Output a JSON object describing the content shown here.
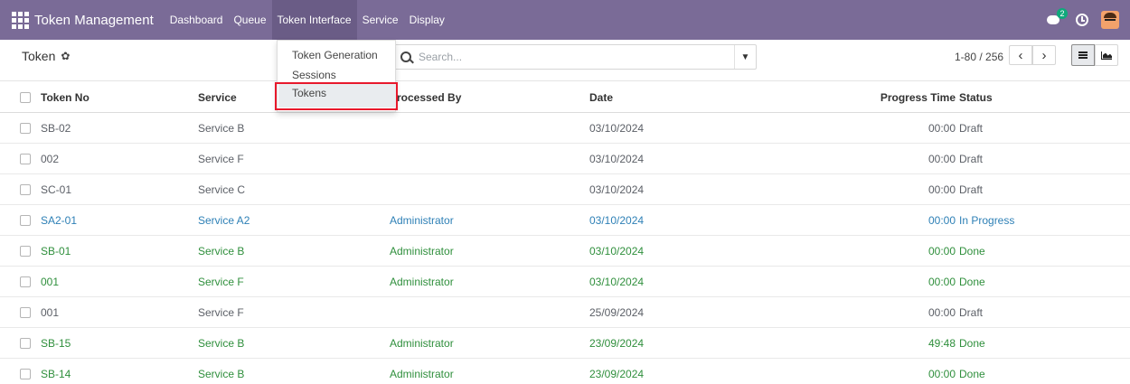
{
  "navbar": {
    "app_name": "Token Management",
    "menu": [
      "Dashboard",
      "Queue",
      "Token Interface",
      "Service",
      "Display"
    ],
    "active_menu": "Token Interface",
    "chat_badge": "2",
    "bg_color": "#7a6b97"
  },
  "dropdown": {
    "items": [
      "Token Generation",
      "Sessions",
      "Tokens"
    ],
    "highlighted": "Tokens"
  },
  "control": {
    "title": "Token",
    "search_placeholder": "Search...",
    "pager": "1-80 / 256",
    "prev": "‹",
    "next": "›"
  },
  "table": {
    "headers": [
      "Token No",
      "Service",
      "Processed By",
      "Date",
      "Progress Time",
      "Status"
    ],
    "rows": [
      {
        "token": "SB-02",
        "service": "Service B",
        "by": "",
        "date": "03/10/2024",
        "time": "00:00",
        "status": "Draft",
        "state": "draft"
      },
      {
        "token": "002",
        "service": "Service F",
        "by": "",
        "date": "03/10/2024",
        "time": "00:00",
        "status": "Draft",
        "state": "draft"
      },
      {
        "token": "SC-01",
        "service": "Service C",
        "by": "",
        "date": "03/10/2024",
        "time": "00:00",
        "status": "Draft",
        "state": "draft"
      },
      {
        "token": "SA2-01",
        "service": "Service A2",
        "by": "Administrator",
        "date": "03/10/2024",
        "time": "00:00",
        "status": "In Progress",
        "state": "progress"
      },
      {
        "token": "SB-01",
        "service": "Service B",
        "by": "Administrator",
        "date": "03/10/2024",
        "time": "00:00",
        "status": "Done",
        "state": "done"
      },
      {
        "token": "001",
        "service": "Service F",
        "by": "Administrator",
        "date": "03/10/2024",
        "time": "00:00",
        "status": "Done",
        "state": "done"
      },
      {
        "token": "001",
        "service": "Service F",
        "by": "",
        "date": "25/09/2024",
        "time": "00:00",
        "status": "Draft",
        "state": "draft"
      },
      {
        "token": "SB-15",
        "service": "Service B",
        "by": "Administrator",
        "date": "23/09/2024",
        "time": "49:48",
        "status": "Done",
        "state": "done"
      },
      {
        "token": "SB-14",
        "service": "Service B",
        "by": "Administrator",
        "date": "23/09/2024",
        "time": "00:00",
        "status": "Done",
        "state": "done"
      }
    ]
  }
}
